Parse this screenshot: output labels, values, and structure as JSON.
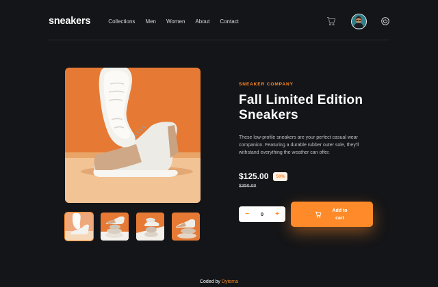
{
  "brand": {
    "logo": "sneakers"
  },
  "nav": {
    "links": [
      "Collections",
      "Men",
      "Women",
      "About",
      "Contact"
    ]
  },
  "icons": {
    "cart": "cart-icon",
    "avatar": "avatar",
    "power": "power-icon",
    "add_to_cart": "cart-icon"
  },
  "colors": {
    "background": "#141518",
    "accent": "#ff8a29",
    "badge_bg": "#fff1e6",
    "text": "#ffffff",
    "muted": "#bfc0c5"
  },
  "product": {
    "company": "SNEAKER COMPANY",
    "title": "Fall Limited Edition Sneakers",
    "description": "These low-profile sneakers are your perfect casual wear companion. Featuring a durable rubber outer sole, they'll withstand everything the weather can offer.",
    "price": "$125.00",
    "discount": "50%",
    "original_price": "$250.00"
  },
  "quantity": {
    "minus": "−",
    "value": "0",
    "plus": "+"
  },
  "add_to_cart": {
    "label": "Add to cart"
  },
  "gallery": {
    "selected_index": 0,
    "thumbnail_count": 4
  },
  "footer": {
    "prefix": "Coded by",
    "author": "Dytoma"
  }
}
